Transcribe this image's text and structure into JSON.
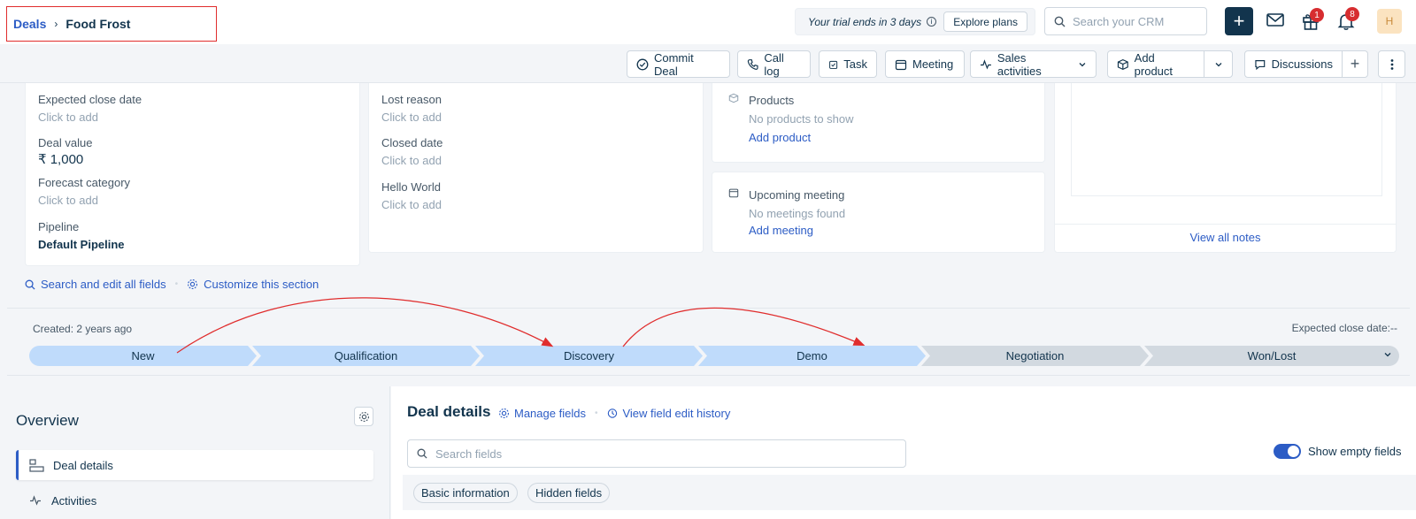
{
  "breadcrumb": {
    "parent": "Deals",
    "current": "Food Frost"
  },
  "topbar": {
    "trial_text": "Your trial ends in 3 days",
    "explore_label": "Explore plans",
    "search_placeholder": "Search your CRM",
    "gift_badge": "1",
    "notif_badge": "8",
    "avatar_initial": "H"
  },
  "actions": {
    "commit": "Commit Deal",
    "call": "Call log",
    "task": "Task",
    "meeting": "Meeting",
    "sales": "Sales activities",
    "add_product": "Add product",
    "discussions": "Discussions"
  },
  "card1": {
    "exp_close_label": "Expected close date",
    "exp_close_value": "Click to add",
    "deal_value_label": "Deal value",
    "deal_value": "₹ 1,000",
    "forecast_label": "Forecast category",
    "forecast_value": "Click to add",
    "pipeline_label": "Pipeline",
    "pipeline_value": "Default Pipeline"
  },
  "card2": {
    "lost_label": "Lost reason",
    "lost_value": "Click to add",
    "closed_label": "Closed date",
    "closed_value": "Click to add",
    "hello_label": "Hello World",
    "hello_value": "Click to add"
  },
  "products": {
    "title": "Products",
    "empty": "No products to show",
    "link": "Add product"
  },
  "meetings": {
    "title": "Upcoming meeting",
    "empty": "No meetings found",
    "link": "Add meeting"
  },
  "notes": {
    "link": "View all notes"
  },
  "field_links": {
    "search": "Search and edit all fields",
    "customize": "Customize this section"
  },
  "pipeline": {
    "created": "Created: 2 years ago",
    "expected": "Expected close date:--",
    "stages": [
      "New",
      "Qualification",
      "Discovery",
      "Demo",
      "Negotiation",
      "Won/Lost"
    ],
    "active_color": "#bfdbfb",
    "inactive_color": "#d2d9e0"
  },
  "overview": {
    "title": "Overview",
    "items": [
      "Deal details",
      "Activities"
    ]
  },
  "deal_details": {
    "title": "Deal details",
    "manage": "Manage fields",
    "history": "View field edit history",
    "search_placeholder": "Search fields",
    "toggle_label": "Show empty fields",
    "tabs": [
      "Basic information",
      "Hidden fields"
    ]
  }
}
